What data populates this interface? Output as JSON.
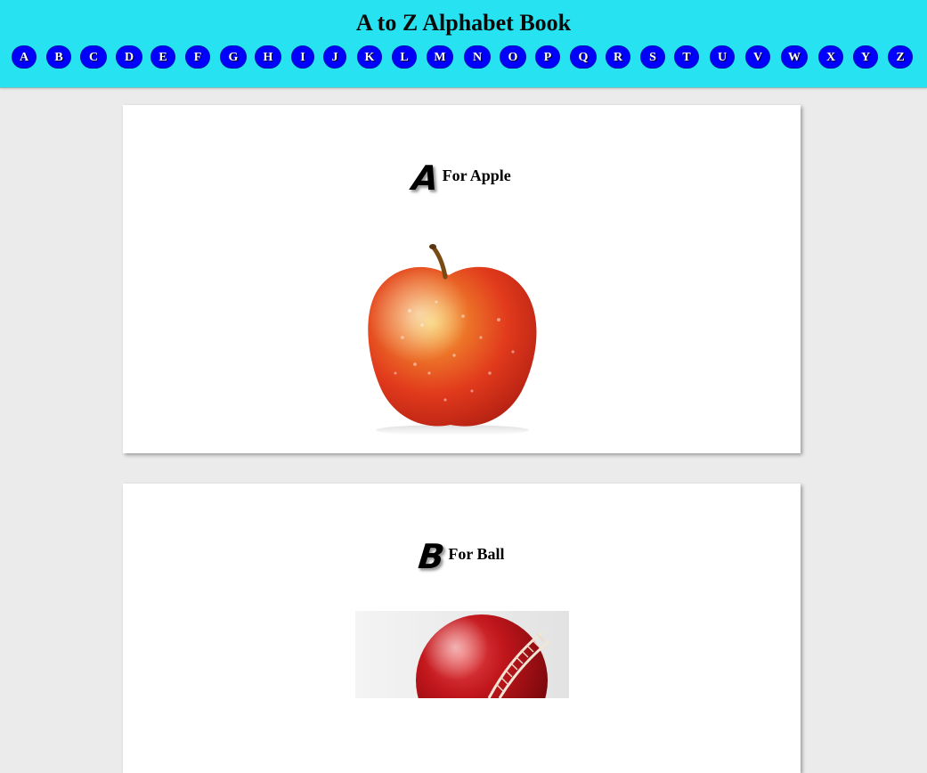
{
  "header": {
    "title": "A to Z Alphabet Book",
    "background": "#27e3f1",
    "letters": [
      "A",
      "B",
      "C",
      "D",
      "E",
      "F",
      "G",
      "H",
      "I",
      "J",
      "K",
      "L",
      "M",
      "N",
      "O",
      "P",
      "Q",
      "R",
      "S",
      "T",
      "U",
      "V",
      "W",
      "X",
      "Y",
      "Z"
    ],
    "button_color": "#0000ff"
  },
  "cards": [
    {
      "letter": "A",
      "text": "For Apple",
      "image": "apple-image"
    },
    {
      "letter": "B",
      "text": "For Ball",
      "image": "cricket-ball-image"
    }
  ]
}
